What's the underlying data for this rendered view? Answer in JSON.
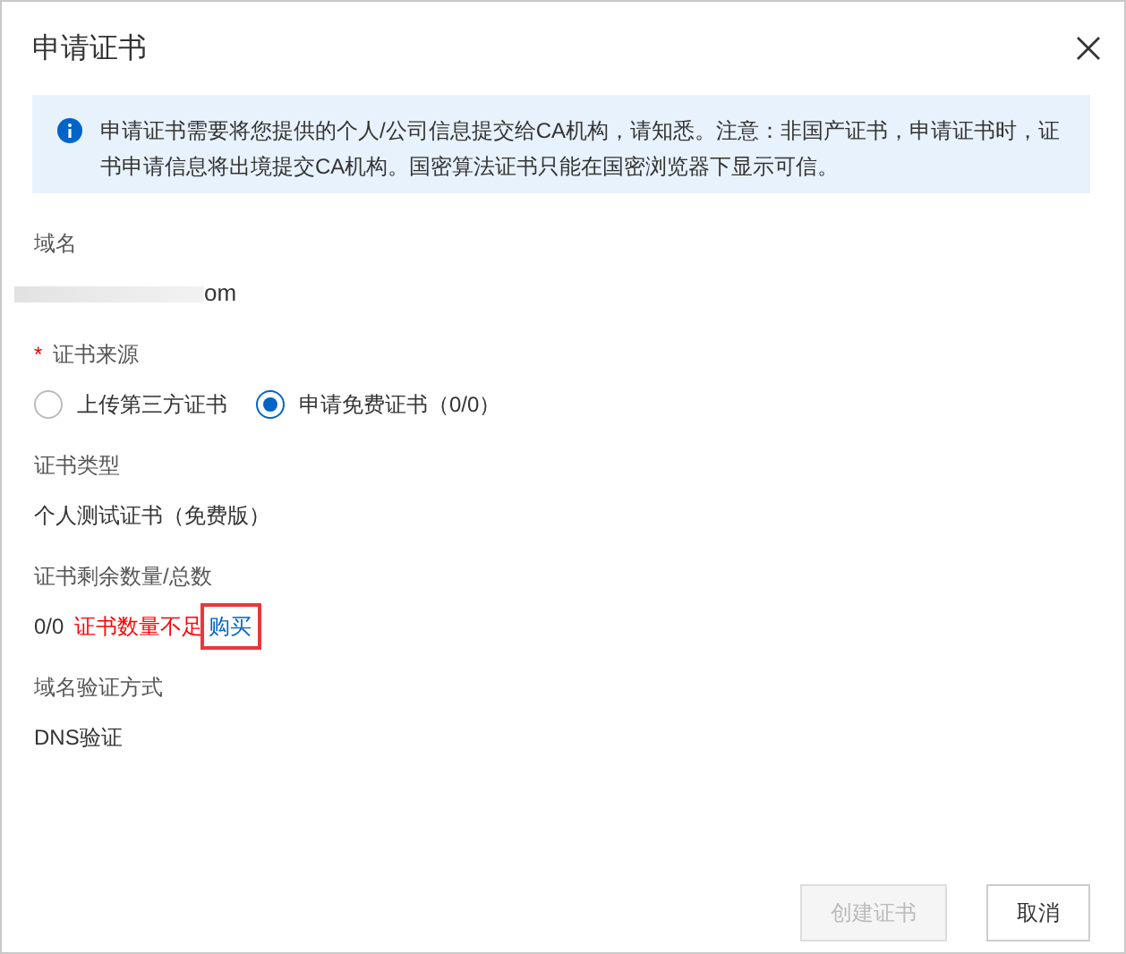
{
  "dialog": {
    "title": "申请证书"
  },
  "notice": {
    "text": "申请证书需要将您提供的个人/公司信息提交给CA机构，请知悉。注意：非国产证书，申请证书时，证书申请信息将出境提交CA机构。国密算法证书只能在国密浏览器下显示可信。"
  },
  "domain": {
    "label": "域名",
    "value": "om",
    "redacted": true
  },
  "source": {
    "label": "证书来源",
    "required_mark": "*",
    "options": [
      {
        "label": "上传第三方证书",
        "selected": false
      },
      {
        "label": "申请免费证书（0/0）",
        "selected": true
      }
    ]
  },
  "type": {
    "label": "证书类型",
    "value": "个人测试证书（免费版）"
  },
  "remaining": {
    "label": "证书剩余数量/总数",
    "value": "0/0",
    "warning": "证书数量不足",
    "link": "购买",
    "highlighted": true
  },
  "verification": {
    "label": "域名验证方式",
    "value": "DNS验证"
  },
  "buttons": [
    {
      "label": "创建证书",
      "kind": "primary",
      "disabled": true
    },
    {
      "label": "取消",
      "kind": "default",
      "disabled": false
    }
  ]
}
